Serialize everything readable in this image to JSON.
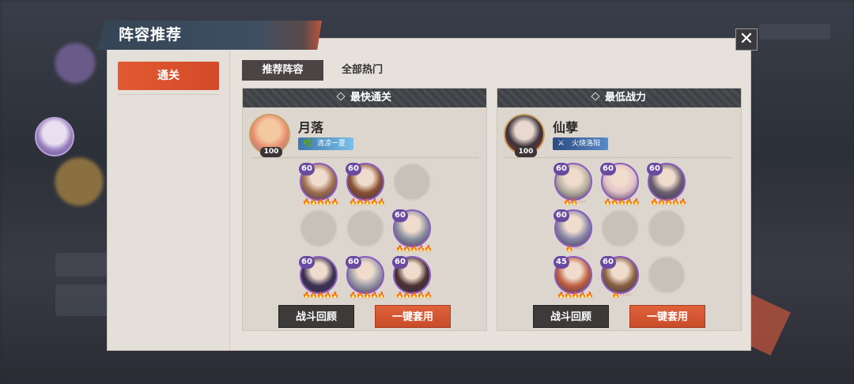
{
  "window": {
    "title": "阵容推荐",
    "close_icon": "close-icon"
  },
  "stage_tabs": [
    {
      "label": "通关",
      "active": true
    }
  ],
  "sub_tabs": [
    {
      "label": "推荐阵容",
      "active": true
    },
    {
      "label": "全部热门",
      "active": false
    }
  ],
  "cards": [
    {
      "header": "最快通关",
      "leader": {
        "name": "月落",
        "level": "100",
        "tag": "清凉一夏",
        "tag_icon": "leaf-icon"
      },
      "slots": [
        {
          "level": "60",
          "stars": 5,
          "color": "#a07050"
        },
        {
          "level": "60",
          "stars": 5,
          "color": "#8a5030"
        },
        {
          "empty": true
        },
        {
          "empty": true
        },
        {
          "empty": true
        },
        {
          "level": "60",
          "stars": 5,
          "color": "#8a90a0"
        },
        {
          "level": "60",
          "stars": 5,
          "color": "#3a3050"
        },
        {
          "level": "60",
          "stars": 5,
          "color": "#9a9aa8"
        },
        {
          "level": "60",
          "stars": 5,
          "color": "#4a3030"
        }
      ],
      "buttons": {
        "review": "战斗回顾",
        "apply": "一键套用"
      }
    },
    {
      "header": "最低战力",
      "leader": {
        "name": "仙孽",
        "level": "100",
        "tag": "火烧洛阳",
        "tag_icon": "crossed-swords-icon"
      },
      "slots": [
        {
          "level": "60",
          "stars": 2,
          "color": "#b8b0a0"
        },
        {
          "level": "60",
          "stars": 5,
          "color": "#e0c0c8"
        },
        {
          "level": "60",
          "stars": 5,
          "color": "#6a6070"
        },
        {
          "level": "60",
          "stars": 1,
          "color": "#8a88a8"
        },
        {
          "empty": true
        },
        {
          "empty": true
        },
        {
          "level": "45",
          "stars": 5,
          "color": "#c06040"
        },
        {
          "level": "60",
          "stars": 1,
          "color": "#8a6040"
        },
        {
          "empty": true
        }
      ],
      "buttons": {
        "review": "战斗回顾",
        "apply": "一键套用"
      }
    }
  ]
}
